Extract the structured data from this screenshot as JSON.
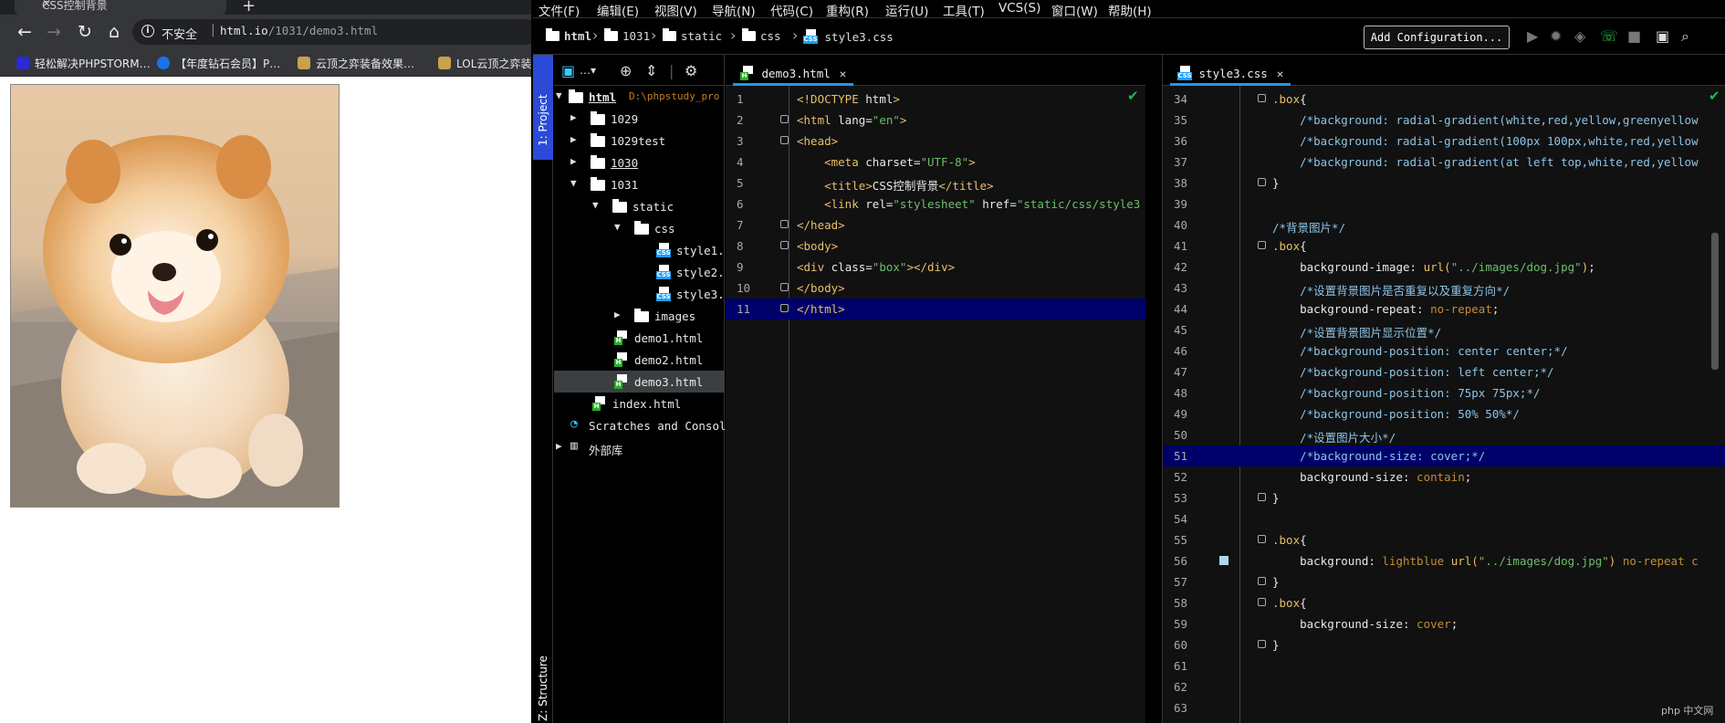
{
  "browser": {
    "tab_title": "CSS控制背景",
    "security_label": "不安全",
    "url_host": "html.io",
    "url_path": "/1031/demo3.html",
    "bookmarks": [
      {
        "label": "轻松解决PHPSTORM…",
        "icon": "phpstorm-icon",
        "color": "#2b2bd6"
      },
      {
        "label": "【年度钻石会员】P…",
        "icon": "bing-icon",
        "color": "#1a73e8"
      },
      {
        "label": "云顶之弈装备效果…",
        "icon": "game-icon",
        "color": "#c8a14a"
      },
      {
        "label": "LOL云顶之弈装…",
        "icon": "game-icon",
        "color": "#c8a14a"
      }
    ],
    "page_image": "dog-photo"
  },
  "ide": {
    "menu": [
      "文件(F)",
      "编辑(E)",
      "视图(V)",
      "导航(N)",
      "代码(C)",
      "重构(R)",
      "运行(U)",
      "工具(T)",
      "VCS(S)",
      "窗口(W)",
      "帮助(H)"
    ],
    "breadcrumbs": [
      "html",
      "1031",
      "static",
      "css",
      "style3.css"
    ],
    "add_config_label": "Add Configuration...",
    "left_strip": {
      "project_label": "1: Project",
      "structure_label": "Z: Structure"
    },
    "project_tree": [
      {
        "name": "html",
        "extra": "D:\\phpstudy_pro",
        "kind": "folder",
        "depth": 0,
        "expanded": true
      },
      {
        "name": "1029",
        "kind": "folder",
        "depth": 1,
        "expanded": false
      },
      {
        "name": "1029test",
        "kind": "folder",
        "depth": 1,
        "expanded": false
      },
      {
        "name": "1030",
        "kind": "folder",
        "depth": 1,
        "expanded": false
      },
      {
        "name": "1031",
        "kind": "folder",
        "depth": 1,
        "expanded": true
      },
      {
        "name": "static",
        "kind": "folder",
        "depth": 2,
        "expanded": true
      },
      {
        "name": "css",
        "kind": "folder",
        "depth": 3,
        "expanded": true
      },
      {
        "name": "style1.c",
        "kind": "css",
        "depth": 4
      },
      {
        "name": "style2.c",
        "kind": "css",
        "depth": 4
      },
      {
        "name": "style3.c",
        "kind": "css",
        "depth": 4
      },
      {
        "name": "images",
        "kind": "folder",
        "depth": 3,
        "expanded": false
      },
      {
        "name": "demo1.html",
        "kind": "html",
        "depth": 3
      },
      {
        "name": "demo2.html",
        "kind": "html",
        "depth": 3
      },
      {
        "name": "demo3.html",
        "kind": "html",
        "depth": 3,
        "selected": true
      },
      {
        "name": "index.html",
        "kind": "html",
        "depth": 2
      },
      {
        "name": "Scratches and Console",
        "kind": "scratch",
        "depth": 0
      },
      {
        "name": "外部库",
        "kind": "lib",
        "depth": 0
      }
    ],
    "html_editor": {
      "tab_label": "demo3.html",
      "lines": [
        {
          "n": "1",
          "parts": [
            [
              "t-tag",
              "<!DOCTYPE "
            ],
            [
              "t-plain",
              "html"
            ],
            [
              "t-tag",
              ">"
            ]
          ]
        },
        {
          "n": "2",
          "parts": [
            [
              "t-tag",
              "<html "
            ],
            [
              "t-attr",
              "lang="
            ],
            [
              "t-str",
              "\"en\""
            ],
            [
              "t-tag",
              ">"
            ]
          ]
        },
        {
          "n": "3",
          "parts": [
            [
              "t-tag",
              "<head>"
            ]
          ]
        },
        {
          "n": "4",
          "parts": [
            [
              "t-plain",
              "    "
            ],
            [
              "t-tag",
              "<meta "
            ],
            [
              "t-attr",
              "charset="
            ],
            [
              "t-str",
              "\"UTF-8\""
            ],
            [
              "t-tag",
              ">"
            ]
          ]
        },
        {
          "n": "5",
          "parts": [
            [
              "t-plain",
              "    "
            ],
            [
              "t-tag",
              "<title>"
            ],
            [
              "t-plain",
              "CSS控制背景"
            ],
            [
              "t-tag",
              "</title>"
            ]
          ]
        },
        {
          "n": "6",
          "parts": [
            [
              "t-plain",
              "    "
            ],
            [
              "t-tag",
              "<link "
            ],
            [
              "t-attr",
              "rel="
            ],
            [
              "t-str",
              "\"stylesheet\" "
            ],
            [
              "t-attr",
              "href="
            ],
            [
              "t-str",
              "\"static/css/style3"
            ]
          ]
        },
        {
          "n": "7",
          "parts": [
            [
              "t-tag",
              "</head>"
            ]
          ]
        },
        {
          "n": "8",
          "parts": [
            [
              "t-tag",
              "<body>"
            ]
          ]
        },
        {
          "n": "9",
          "parts": [
            [
              "t-tag",
              "<div "
            ],
            [
              "t-attr",
              "class="
            ],
            [
              "t-str",
              "\"box\""
            ],
            [
              "t-tag",
              "></div>"
            ]
          ]
        },
        {
          "n": "10",
          "parts": [
            [
              "t-tag",
              "</body>"
            ]
          ]
        },
        {
          "n": "11",
          "parts": [
            [
              "t-tag",
              "</html>"
            ]
          ],
          "highlight": true
        }
      ]
    },
    "css_editor": {
      "tab_label": "style3.css",
      "lines": [
        {
          "n": "34",
          "parts": [
            [
              "t-sel",
              ".box"
            ],
            [
              "t-plain",
              "{"
            ]
          ]
        },
        {
          "n": "35",
          "parts": [
            [
              "t-plain",
              "    "
            ],
            [
              "t-cmt",
              "/*background: radial-gradient(white,red,yellow,greenyellow"
            ]
          ]
        },
        {
          "n": "36",
          "parts": [
            [
              "t-plain",
              "    "
            ],
            [
              "t-cmt",
              "/*background: radial-gradient(100px 100px,white,red,yellow"
            ]
          ]
        },
        {
          "n": "37",
          "parts": [
            [
              "t-plain",
              "    "
            ],
            [
              "t-cmt",
              "/*background: radial-gradient(at left top,white,red,yellow"
            ]
          ]
        },
        {
          "n": "38",
          "parts": [
            [
              "t-plain",
              "}"
            ]
          ]
        },
        {
          "n": "39",
          "parts": []
        },
        {
          "n": "40",
          "parts": [
            [
              "t-cmt",
              "/*背景图片*/"
            ]
          ]
        },
        {
          "n": "41",
          "parts": [
            [
              "t-sel",
              ".box"
            ],
            [
              "t-plain",
              "{"
            ]
          ]
        },
        {
          "n": "42",
          "parts": [
            [
              "t-plain",
              "    "
            ],
            [
              "t-prop",
              "background-image: "
            ],
            [
              "t-fn",
              "url("
            ],
            [
              "t-str",
              "\"../images/dog.jpg\""
            ],
            [
              "t-fn",
              ")"
            ],
            [
              "t-plain",
              ";"
            ]
          ]
        },
        {
          "n": "43",
          "parts": [
            [
              "t-plain",
              "    "
            ],
            [
              "t-cmt",
              "/*设置背景图片是否重复以及重复方向*/"
            ]
          ]
        },
        {
          "n": "44",
          "parts": [
            [
              "t-plain",
              "    "
            ],
            [
              "t-prop",
              "background-repeat: "
            ],
            [
              "t-val",
              "no-repeat"
            ],
            [
              "t-plain",
              ";"
            ]
          ]
        },
        {
          "n": "45",
          "parts": [
            [
              "t-plain",
              "    "
            ],
            [
              "t-cmt",
              "/*设置背景图片显示位置*/"
            ]
          ]
        },
        {
          "n": "46",
          "parts": [
            [
              "t-plain",
              "    "
            ],
            [
              "t-cmt",
              "/*background-position: center center;*/"
            ]
          ]
        },
        {
          "n": "47",
          "parts": [
            [
              "t-plain",
              "    "
            ],
            [
              "t-cmt",
              "/*background-position: left center;*/"
            ]
          ]
        },
        {
          "n": "48",
          "parts": [
            [
              "t-plain",
              "    "
            ],
            [
              "t-cmt",
              "/*background-position: 75px 75px;*/"
            ]
          ]
        },
        {
          "n": "49",
          "parts": [
            [
              "t-plain",
              "    "
            ],
            [
              "t-cmt",
              "/*background-position: 50% 50%*/"
            ]
          ]
        },
        {
          "n": "50",
          "parts": [
            [
              "t-plain",
              "    "
            ],
            [
              "t-cmt",
              "/*设置图片大小*/"
            ]
          ]
        },
        {
          "n": "51",
          "parts": [
            [
              "t-plain",
              "    "
            ],
            [
              "t-cmt",
              "/*background-size: cover;*/"
            ]
          ],
          "highlight": true
        },
        {
          "n": "52",
          "parts": [
            [
              "t-plain",
              "    "
            ],
            [
              "t-prop",
              "background-size: "
            ],
            [
              "t-val",
              "contain"
            ],
            [
              "t-plain",
              ";"
            ]
          ]
        },
        {
          "n": "53",
          "parts": [
            [
              "t-plain",
              "}"
            ]
          ]
        },
        {
          "n": "54",
          "parts": []
        },
        {
          "n": "55",
          "parts": [
            [
              "t-sel",
              ".box"
            ],
            [
              "t-plain",
              "{"
            ]
          ]
        },
        {
          "n": "56",
          "parts": [
            [
              "t-plain",
              "    "
            ],
            [
              "t-prop",
              "background: "
            ],
            [
              "t-val",
              "lightblue "
            ],
            [
              "t-fn",
              "url("
            ],
            [
              "t-str",
              "\"../images/dog.jpg\""
            ],
            [
              "t-fn",
              ") "
            ],
            [
              "t-val",
              "no-repeat c"
            ]
          ],
          "swatch": "#add8e6"
        },
        {
          "n": "57",
          "parts": [
            [
              "t-plain",
              "}"
            ]
          ]
        },
        {
          "n": "58",
          "parts": [
            [
              "t-sel",
              ".box"
            ],
            [
              "t-plain",
              "{"
            ]
          ]
        },
        {
          "n": "59",
          "parts": [
            [
              "t-plain",
              "    "
            ],
            [
              "t-prop",
              "background-size: "
            ],
            [
              "t-val",
              "cover"
            ],
            [
              "t-plain",
              ";"
            ]
          ]
        },
        {
          "n": "60",
          "parts": [
            [
              "t-plain",
              "}"
            ]
          ]
        },
        {
          "n": "61",
          "parts": []
        },
        {
          "n": "62",
          "parts": []
        },
        {
          "n": "63",
          "parts": []
        }
      ]
    },
    "browser_icons": [
      "chrome-icon",
      "firefox-icon",
      "safari-icon",
      "opera-icon",
      "ie-icon",
      "edge-icon"
    ],
    "watermark": "php 中文网"
  }
}
